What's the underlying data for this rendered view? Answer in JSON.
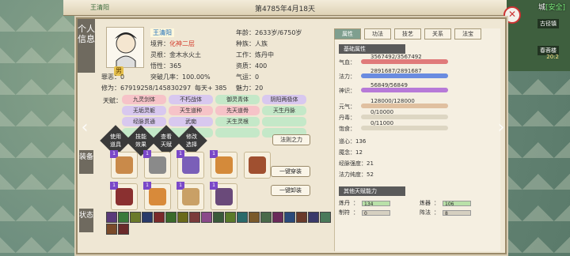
{
  "top": {
    "date": "第4785年4月18天",
    "left_label": "王清阳"
  },
  "map": {
    "title": "城",
    "safe": "[安全]",
    "loc1": "古径镇",
    "loc2": "春蓉楼",
    "time": "20:2"
  },
  "sidebar": {
    "profile": "个人信息",
    "equip": "装备",
    "status": "状态"
  },
  "character": {
    "name": "王清阳",
    "gender": "男",
    "realm_label": "境界",
    "realm": "化神二层",
    "root_label": "灵根",
    "root": "金木水火土",
    "insight_label": "悟性",
    "insight": "365",
    "evil_label": "罪恶",
    "evil": "0",
    "break_label": "突破几率",
    "break": "100.00%",
    "cultivation_label": "修为",
    "cultivation": "67919258/145830297",
    "per_day_label": "每天",
    "per_day": "+ 385",
    "age_label": "年龄",
    "age": "2633岁/6750岁",
    "race_label": "种族",
    "race": "人族",
    "job_label": "工作",
    "job": "炼丹中",
    "aptitude_label": "资质",
    "aptitude": "400",
    "qi_label": "气运",
    "qi": "0",
    "charm_label": "魅力",
    "charm": "20",
    "seal": "卸"
  },
  "talents": {
    "label": "天赋",
    "items": [
      "九灵剑体",
      "不朽战体",
      "御灵青体",
      "阴阳两极体",
      "无垢灵躯",
      "天生道种",
      "先天道骨",
      "天生丹脉",
      "经脉贯通",
      "武痴",
      "天生灵根",
      "",
      "",
      "",
      "",
      ""
    ]
  },
  "mini_tabs": [
    "使用道具",
    "技能效果",
    "查看天赋",
    "修改选择"
  ],
  "buttons": {
    "meridian": "法则之力",
    "wear_all": "一键穿装",
    "unequip_all": "一键卸装"
  },
  "equipment": [
    {
      "level": "1",
      "color": "#c98a4a"
    },
    {
      "level": "1",
      "color": "#8a8a8a"
    },
    {
      "level": "1",
      "color": "#7a5fb8"
    },
    {
      "level": "1",
      "color": "#d48a3a"
    },
    {
      "level": "",
      "color": "#a05030"
    },
    {
      "level": "1",
      "color": "#8a3030"
    },
    {
      "level": "1",
      "color": "#d88a3a"
    },
    {
      "level": "1",
      "color": "#c9a066"
    },
    {
      "level": "1",
      "color": "#6a4a7a"
    }
  ],
  "status_icons": [
    "#5a3a7a",
    "#3a7a3a",
    "#6a7a2a",
    "#2a3a6a",
    "#7a2a2a",
    "#3a6a2a",
    "#6a6a1a",
    "#7a3a3a",
    "#8a4a8a",
    "#3a5a3a",
    "#5a7a2a",
    "#2a6a6a",
    "#7a5a2a",
    "#4a6a4a",
    "#6a2a5a",
    "#2a4a7a",
    "#6a3a2a",
    "#3a3a6a",
    "#4a7a5a",
    "#7a4a2a",
    "#6a2a2a"
  ],
  "tabs": [
    "属性",
    "功法",
    "技艺",
    "关系",
    "法宝"
  ],
  "base_attr": {
    "title": "基础属性",
    "qi_blood_label": "气血",
    "qi_blood": "3567492/3567492",
    "mana_label": "法力",
    "mana": "2891687/2891687",
    "sense_label": "神识",
    "sense": "56849/56849",
    "primal_label": "元气",
    "primal": "128000/128000",
    "dan_label": "丹毒",
    "dan": "0/10000",
    "full_label": "饱食",
    "full": "0/11000",
    "heart_label": "道心",
    "heart": "136",
    "nian_label": "魇念",
    "nian": "12",
    "meridian_label": "经脉强度",
    "meridian": "21",
    "purity_label": "法力纯度",
    "purity": "52"
  },
  "other_talent": {
    "title": "其他天赋能力",
    "alchemy_label": "炼丹",
    "alchemy": "134",
    "forge_label": "炼器",
    "forge": "106",
    "talisman_label": "制符",
    "talisman": "0",
    "formation_label": "阵法",
    "formation": "8"
  },
  "colors": {
    "qi_blood": "#e07a7a",
    "mana": "#6a8ce0",
    "sense": "#b77ad8",
    "primal": "#e0c0a0"
  }
}
